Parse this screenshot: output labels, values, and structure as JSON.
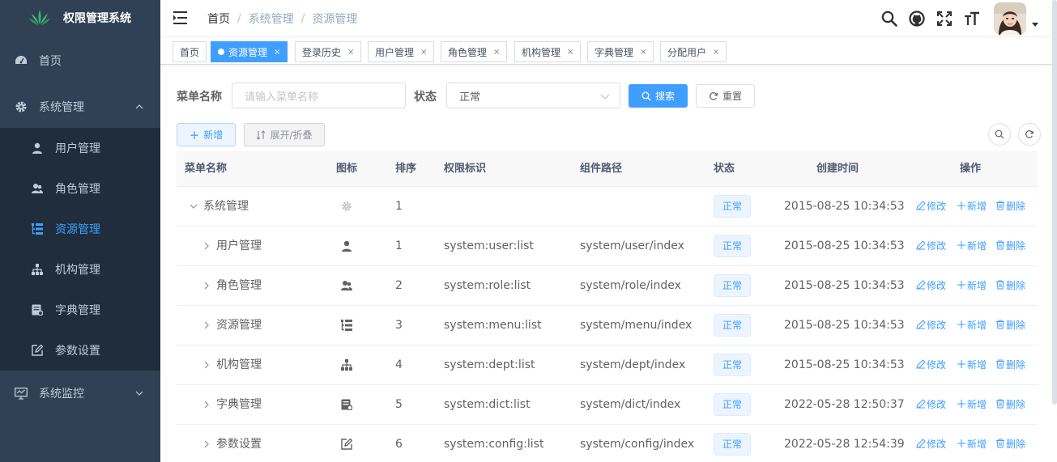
{
  "app": {
    "title": "权限管理系统"
  },
  "sidebar": {
    "items": [
      {
        "label": "首页",
        "icon": "dashboard-icon"
      },
      {
        "label": "系统管理",
        "icon": "gear-icon",
        "expanded": true,
        "children": [
          {
            "label": "用户管理",
            "icon": "user-icon"
          },
          {
            "label": "角色管理",
            "icon": "peoples-icon"
          },
          {
            "label": "资源管理",
            "icon": "tree-table-icon",
            "active": true
          },
          {
            "label": "机构管理",
            "icon": "tree-icon"
          },
          {
            "label": "字典管理",
            "icon": "dict-icon"
          },
          {
            "label": "参数设置",
            "icon": "edit-icon"
          }
        ]
      },
      {
        "label": "系统监控",
        "icon": "monitor-icon",
        "expanded": false
      }
    ]
  },
  "navbar": {
    "breadcrumb": [
      "首页",
      "系统管理",
      "资源管理"
    ],
    "separator": "/"
  },
  "tags": [
    {
      "label": "首页",
      "closable": false,
      "active": false
    },
    {
      "label": "资源管理",
      "closable": true,
      "active": true
    },
    {
      "label": "登录历史",
      "closable": true,
      "active": false
    },
    {
      "label": "用户管理",
      "closable": true,
      "active": false
    },
    {
      "label": "角色管理",
      "closable": true,
      "active": false
    },
    {
      "label": "机构管理",
      "closable": true,
      "active": false
    },
    {
      "label": "字典管理",
      "closable": true,
      "active": false
    },
    {
      "label": "分配用户",
      "closable": true,
      "active": false
    }
  ],
  "close_glyph": "×",
  "search": {
    "menu_name_label": "菜单名称",
    "menu_name_placeholder": "请输入菜单名称",
    "status_label": "状态",
    "status_value": "正常",
    "search_button": "搜索",
    "reset_button": "重置"
  },
  "toolbar": {
    "add_button": "新增",
    "expand_button": "展开/折叠"
  },
  "table": {
    "columns": [
      "菜单名称",
      "图标",
      "排序",
      "权限标识",
      "组件路径",
      "状态",
      "创建时间",
      "操作"
    ],
    "rows": [
      {
        "name": "系统管理",
        "icon": "gear-icon",
        "order": "1",
        "perm": "",
        "path": "",
        "status": "正常",
        "created": "2015-08-25 10:34:53",
        "expanded": true,
        "level": 0
      },
      {
        "name": "用户管理",
        "icon": "user-icon",
        "order": "1",
        "perm": "system:user:list",
        "path": "system/user/index",
        "status": "正常",
        "created": "2015-08-25 10:34:53",
        "expanded": false,
        "level": 1
      },
      {
        "name": "角色管理",
        "icon": "peoples-icon",
        "order": "2",
        "perm": "system:role:list",
        "path": "system/role/index",
        "status": "正常",
        "created": "2015-08-25 10:34:53",
        "expanded": false,
        "level": 1
      },
      {
        "name": "资源管理",
        "icon": "tree-table-icon",
        "order": "3",
        "perm": "system:menu:list",
        "path": "system/menu/index",
        "status": "正常",
        "created": "2015-08-25 10:34:53",
        "expanded": false,
        "level": 1
      },
      {
        "name": "机构管理",
        "icon": "tree-icon",
        "order": "4",
        "perm": "system:dept:list",
        "path": "system/dept/index",
        "status": "正常",
        "created": "2015-08-25 10:34:53",
        "expanded": false,
        "level": 1
      },
      {
        "name": "字典管理",
        "icon": "dict-icon",
        "order": "5",
        "perm": "system:dict:list",
        "path": "system/dict/index",
        "status": "正常",
        "created": "2022-05-28 12:50:37",
        "expanded": false,
        "level": 1
      },
      {
        "name": "参数设置",
        "icon": "edit-icon",
        "order": "6",
        "perm": "system:config:list",
        "path": "system/config/index",
        "status": "正常",
        "created": "2022-05-28 12:54:39",
        "expanded": false,
        "level": 1
      }
    ],
    "actions": {
      "edit": "修改",
      "add": "新增",
      "delete": "删除"
    }
  },
  "colors": {
    "sidebar_bg": "#304156",
    "submenu_bg": "#1f2d3d",
    "primary": "#409eff",
    "menu_text": "#bfcbd9"
  }
}
